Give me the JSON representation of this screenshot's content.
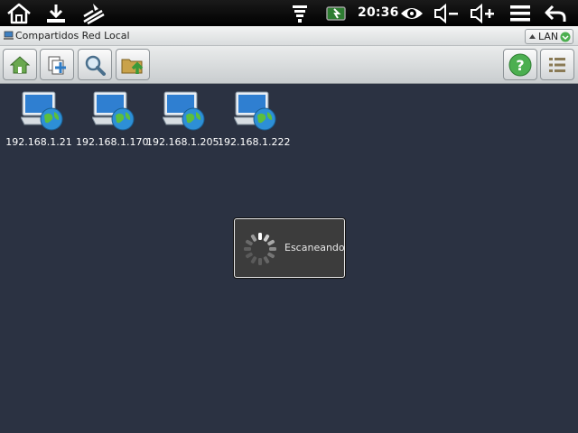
{
  "status_bar": {
    "time": "20:36",
    "icons": [
      "home-icon",
      "download-icon",
      "usb-debug-icon",
      "wifi-icon",
      "battery-icon",
      "eye-icon",
      "volume-down-icon",
      "volume-up-icon",
      "menu-icon",
      "back-icon"
    ]
  },
  "title_bar": {
    "title": "Compartidos Red Local",
    "network_select": "LAN"
  },
  "toolbar": {
    "buttons": [
      "home-icon",
      "add-icon",
      "search-icon",
      "folder-up-icon",
      "help-icon",
      "list-view-icon"
    ]
  },
  "hosts": [
    {
      "label": "192.168.1.21"
    },
    {
      "label": "192.168.1.170"
    },
    {
      "label": "192.168.1.205"
    },
    {
      "label": "192.168.1.222"
    }
  ],
  "dialog": {
    "message": "Escaneando"
  },
  "colors": {
    "background": "#2b3242",
    "status_bar": "#000000",
    "accent_green": "#4caf50"
  }
}
